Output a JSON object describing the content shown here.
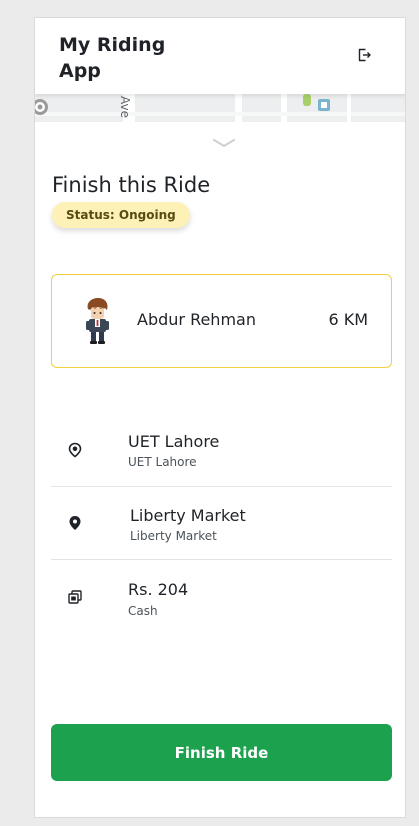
{
  "header": {
    "title": "My Riding App",
    "logout_icon": "logout-icon"
  },
  "map": {
    "street_label": "Ave"
  },
  "ride": {
    "title": "Finish this Ride",
    "status": "Status: Ongoing"
  },
  "rider": {
    "name": "Abdur Rehman",
    "distance": "6 KM",
    "avatar_icon": "rider-avatar"
  },
  "pickup": {
    "title": "UET Lahore",
    "subtitle": "UET Lahore",
    "icon": "pickup-pin-icon"
  },
  "dropoff": {
    "title": "Liberty Market",
    "subtitle": "Liberty Market",
    "icon": "dropoff-pin-icon"
  },
  "fare": {
    "amount": "Rs. 204",
    "method": "Cash",
    "icon": "cash-icon"
  },
  "actions": {
    "finish_label": "Finish Ride"
  },
  "colors": {
    "accent_green": "#1ca24f",
    "status_bg": "#fdf1b8",
    "card_border": "#f3cf44"
  }
}
